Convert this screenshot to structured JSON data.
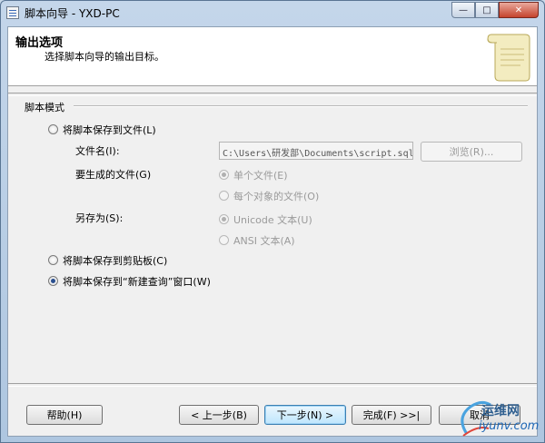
{
  "window": {
    "title": "脚本向导 - YXD-PC",
    "min": "—",
    "max": "□",
    "close": "✕"
  },
  "header": {
    "title": "输出选项",
    "subtitle": "选择脚本向导的输出目标。"
  },
  "group": {
    "label": "脚本模式"
  },
  "options": {
    "save_file": "将脚本保存到文件(L)",
    "file_name_label": "文件名(I):",
    "file_name_value": "C:\\Users\\研发部\\Documents\\script.sql",
    "browse": "浏览(R)...",
    "files_to_generate_label": "要生成的文件(G)",
    "single_file": "单个文件(E)",
    "file_per_object": "每个对象的文件(O)",
    "save_as_label": "另存为(S):",
    "unicode_text": "Unicode 文本(U)",
    "ansi_text": "ANSI 文本(A)",
    "save_clipboard": "将脚本保存到剪贴板(C)",
    "save_new_query": "将脚本保存到“新建查询”窗口(W)"
  },
  "footer": {
    "help": "帮助(H)",
    "back": "< 上一步(B)",
    "next": "下一步(N) >",
    "finish": "完成(F) >>|",
    "cancel": "取消"
  },
  "watermark": {
    "text1": "运维网",
    "text2": "iyunv.com"
  },
  "colors": {
    "titlebar": "#c4d6ea",
    "close_button": "#c5432d",
    "default_button": "#bee6fd"
  }
}
